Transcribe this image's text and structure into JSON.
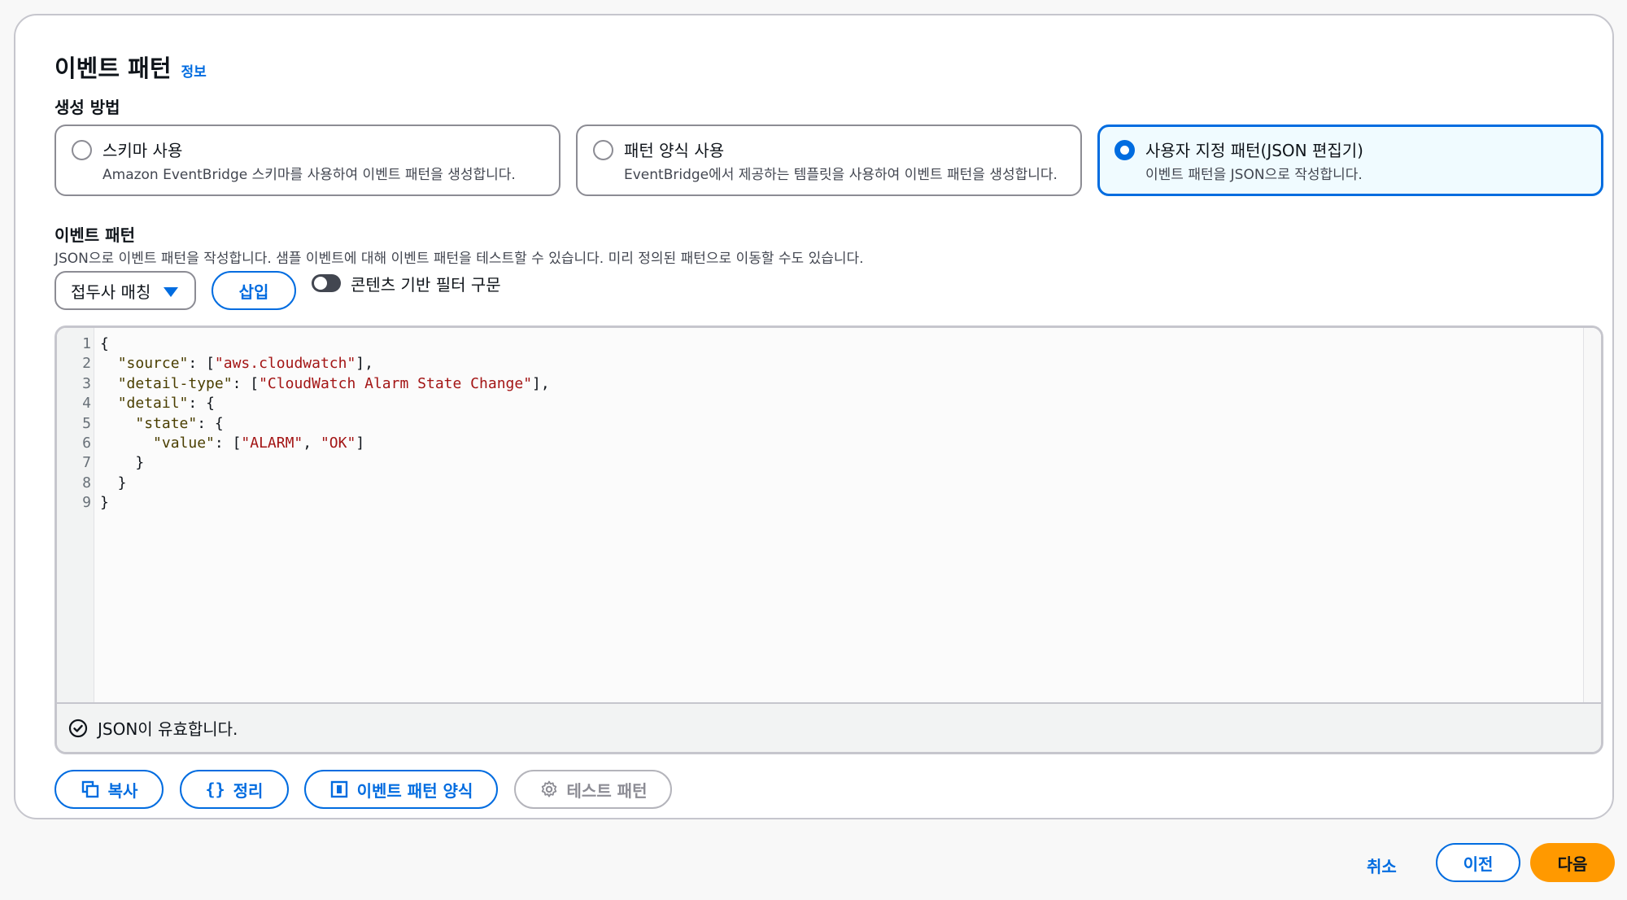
{
  "header": {
    "title": "이벤트 패턴",
    "info_link": "정보"
  },
  "creation_method": {
    "label": "생성 방법",
    "options": [
      {
        "title": "스키마 사용",
        "description": "Amazon EventBridge 스키마를 사용하여 이벤트 패턴을 생성합니다.",
        "selected": false
      },
      {
        "title": "패턴 양식 사용",
        "description": "EventBridge에서 제공하는 템플릿을 사용하여 이벤트 패턴을 생성합니다.",
        "selected": false
      },
      {
        "title": "사용자 지정 패턴(JSON 편집기)",
        "description": "이벤트 패턴을 JSON으로 작성합니다.",
        "selected": true
      }
    ]
  },
  "event_pattern": {
    "label": "이벤트 패턴",
    "description": "JSON으로 이벤트 패턴을 작성합니다. 샘플 이벤트에 대해 이벤트 패턴을 테스트할 수 있습니다. 미리 정의된 패턴으로 이동할 수도 있습니다.",
    "dropdown_value": "접두사 매칭",
    "insert_button": "삽입",
    "toggle_label": "콘텐츠 기반 필터 구문",
    "toggle_on": false
  },
  "editor": {
    "line_numbers": [
      "1",
      "2",
      "3",
      "4",
      "5",
      "6",
      "7",
      "8",
      "9"
    ],
    "lines": [
      "{",
      "  \"source\": [\"aws.cloudwatch\"],",
      "  \"detail-type\": [\"CloudWatch Alarm State Change\"],",
      "  \"detail\": {",
      "    \"state\": {",
      "      \"value\": [\"ALARM\", \"OK\"]",
      "    }",
      "  }",
      "}"
    ],
    "status": "JSON이 유효합니다."
  },
  "actions": {
    "copy": "복사",
    "format": "정리",
    "pattern_form": "이벤트 패턴 양식",
    "test": "테스트 패턴"
  },
  "footer": {
    "cancel": "취소",
    "previous": "이전",
    "next": "다음"
  },
  "colors": {
    "accent": "#006ce0",
    "primary": "#ff9900",
    "border": "#c6c6cd"
  },
  "icons": [
    "copy-icon",
    "braces-icon",
    "form-icon",
    "gear-icon",
    "check-circle-icon",
    "caret-down-icon"
  ]
}
